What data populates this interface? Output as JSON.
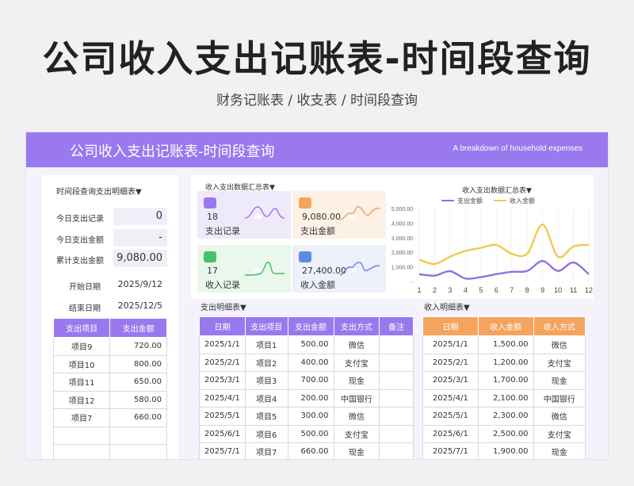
{
  "header": {
    "main_title": "公司收入支出记账表-时间段查询",
    "sub_title": "财务记账表 /  收支表 / 时间段查询"
  },
  "banner": {
    "title": "公司收入支出记账表-时间段查询",
    "subtitle": "A breakdown of household expenses"
  },
  "left": {
    "section_title": "时间段查询支出明细表▼",
    "today_count_label": "今日支出记录",
    "today_count_value": "0",
    "today_amount_label": "今日支出金额",
    "today_amount_value": "-",
    "total_amount_label": "累计支出金额",
    "total_amount_value": "9,080.00",
    "start_label": "开始日期",
    "start_value": "2025/9/12",
    "end_label": "结束日期",
    "end_value": "2025/12/5",
    "table_headers": [
      "支出项目",
      "支出金额"
    ],
    "table_rows": [
      [
        "项目9",
        "720.00"
      ],
      [
        "项目10",
        "800.00"
      ],
      [
        "项目11",
        "650.00"
      ],
      [
        "项目12",
        "580.00"
      ],
      [
        "项目7",
        "660.00"
      ],
      [
        "",
        ""
      ],
      [
        "",
        ""
      ]
    ]
  },
  "summary": {
    "section_title": "收入支出数据汇总表▼",
    "cards": [
      {
        "value": "18",
        "caption": "支出记录",
        "color": "#9a79ee",
        "bg": "#efeaf9",
        "line": "#9a79ee"
      },
      {
        "value": "9,080.00",
        "caption": "支出金额",
        "color": "#f4a45e",
        "bg": "#fdf1e6",
        "line": "#f4a45e"
      },
      {
        "value": "17",
        "caption": "收入记录",
        "color": "#43c26b",
        "bg": "#e9f7ec",
        "line": "#43c26b"
      },
      {
        "value": "27,400.00",
        "caption": "收入金额",
        "color": "#5b8de6",
        "bg": "#eef0fa",
        "line": "#5b8de6"
      }
    ]
  },
  "chart_data": {
    "type": "line",
    "title": "收入支出数据汇总表▼",
    "categories": [
      "1",
      "2",
      "3",
      "4",
      "5",
      "6",
      "7",
      "8",
      "9",
      "10",
      "11",
      "12"
    ],
    "yticks": [
      "5,000.00",
      "4,000.00",
      "3,000.00",
      "2,000.00",
      "1,000.00",
      "-"
    ],
    "ylim": [
      0,
      5000
    ],
    "legend": "top",
    "series": [
      {
        "name": "支出金额",
        "color": "#8e72e3",
        "values": [
          500,
          400,
          700,
          200,
          300,
          500,
          660,
          720,
          1400,
          720,
          1300,
          500
        ]
      },
      {
        "name": "收入金额",
        "color": "#f2c94c",
        "values": [
          1500,
          1200,
          1700,
          2100,
          2300,
          2500,
          1900,
          1900,
          3900,
          1700,
          2400,
          2500
        ]
      }
    ]
  },
  "expense_detail": {
    "section_title": "支出明细表▼",
    "headers": [
      "日期",
      "支出项目",
      "支出金额",
      "支出方式",
      "备注"
    ],
    "rows": [
      [
        "2025/1/1",
        "项目1",
        "500.00",
        "微信",
        ""
      ],
      [
        "2025/2/1",
        "项目2",
        "400.00",
        "支付宝",
        ""
      ],
      [
        "2025/3/1",
        "项目3",
        "700.00",
        "现金",
        ""
      ],
      [
        "2025/4/1",
        "项目4",
        "200.00",
        "中国银行",
        ""
      ],
      [
        "2025/5/1",
        "项目5",
        "300.00",
        "微信",
        ""
      ],
      [
        "2025/6/1",
        "项目6",
        "500.00",
        "支付宝",
        ""
      ],
      [
        "2025/7/1",
        "项目7",
        "660.00",
        "现金",
        ""
      ]
    ]
  },
  "income_detail": {
    "section_title": "收入明细表▼",
    "headers": [
      "日期",
      "收入金额",
      "收入方式"
    ],
    "rows": [
      [
        "2025/1/1",
        "1,500.00",
        "微信"
      ],
      [
        "2025/2/1",
        "1,200.00",
        "支付宝"
      ],
      [
        "2025/3/1",
        "1,700.00",
        "现金"
      ],
      [
        "2025/4/1",
        "2,100.00",
        "中国银行"
      ],
      [
        "2025/5/1",
        "2,300.00",
        "微信"
      ],
      [
        "2025/6/1",
        "2,500.00",
        "支付宝"
      ],
      [
        "2025/7/1",
        "1,900.00",
        "现金"
      ]
    ]
  }
}
